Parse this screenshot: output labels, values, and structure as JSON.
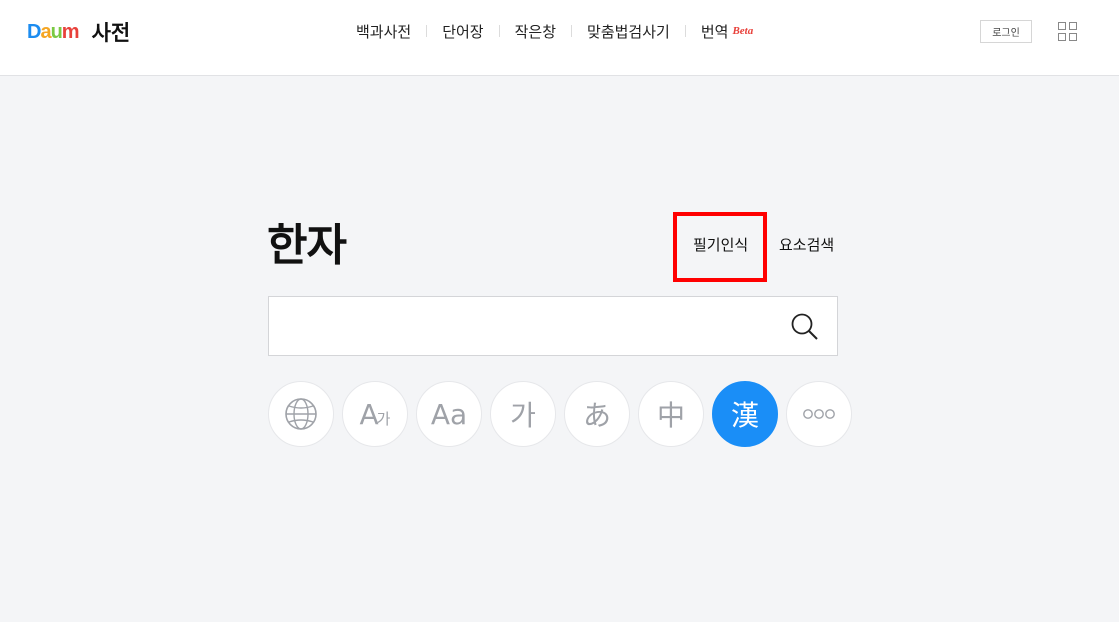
{
  "header": {
    "logo": {
      "text": "Daum",
      "service": "사전"
    },
    "nav": [
      {
        "label": "백과사전"
      },
      {
        "label": "단어장"
      },
      {
        "label": "작은창"
      },
      {
        "label": "맞춤법검사기"
      },
      {
        "label": "번역",
        "badge": "Beta"
      }
    ],
    "login_label": "로그인"
  },
  "main": {
    "title": "한자",
    "tools": {
      "handwriting": "필기인식",
      "radical_search": "요소검색"
    },
    "search": {
      "value": "",
      "placeholder": ""
    },
    "languages": [
      {
        "id": "all",
        "glyph": "",
        "icon": "globe-icon"
      },
      {
        "id": "english-korean",
        "glyph": "A",
        "glyph_small": "가"
      },
      {
        "id": "english",
        "glyph": "Aa"
      },
      {
        "id": "korean",
        "glyph": "가"
      },
      {
        "id": "japanese",
        "glyph": "あ"
      },
      {
        "id": "chinese",
        "glyph": "中"
      },
      {
        "id": "hanja",
        "glyph": "漢",
        "active": true
      },
      {
        "id": "more",
        "glyph": "",
        "icon": "more-dots-icon"
      }
    ]
  },
  "colors": {
    "accent": "#1a8ef7",
    "highlight": "#ff0000",
    "beta": "#e8413b",
    "background": "#f4f5f7"
  }
}
